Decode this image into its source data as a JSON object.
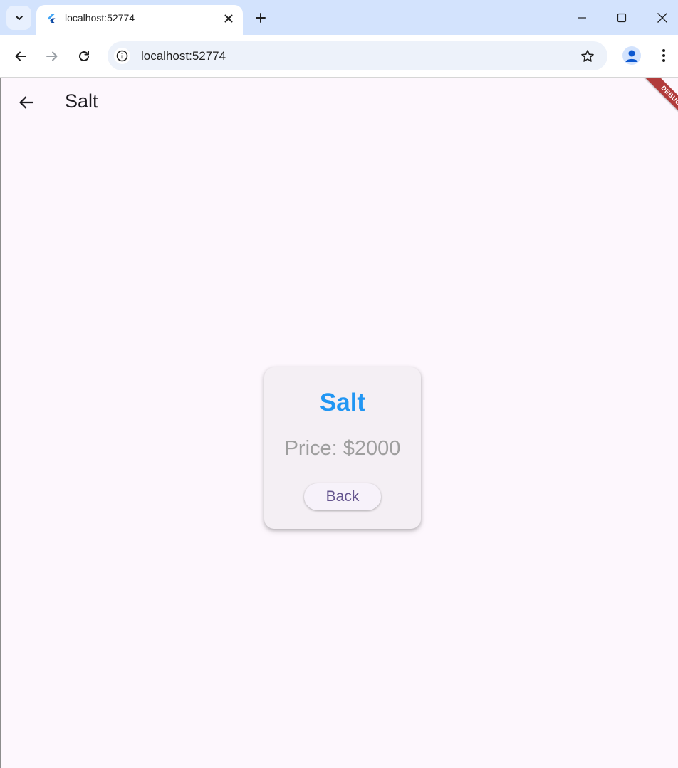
{
  "browser": {
    "tab": {
      "title": "localhost:52774"
    },
    "address_bar": {
      "url": "localhost:52774"
    },
    "icons": {
      "tab_search": "chevron-down-icon",
      "favicon": "flutter-logo-icon",
      "tab_close": "close-icon",
      "new_tab": "plus-icon",
      "minimize": "minimize-icon",
      "maximize": "maximize-icon",
      "close_window": "close-icon",
      "back": "arrow-left-icon",
      "forward": "arrow-right-icon",
      "reload": "reload-icon",
      "site_info": "info-icon",
      "bookmark": "star-icon",
      "profile": "person-icon",
      "menu": "kebab-menu-icon"
    }
  },
  "app": {
    "appbar": {
      "title": "Salt"
    },
    "debug_banner": "DEBUG",
    "card": {
      "title": "Salt",
      "price": "Price: $2000",
      "back_label": "Back"
    },
    "colors": {
      "background": "#fdf7fd",
      "card": "#f4eff4",
      "title": "#2196f3",
      "price": "#9e9e9e",
      "button_text": "#65558f",
      "debug": "#b13b3b"
    }
  }
}
